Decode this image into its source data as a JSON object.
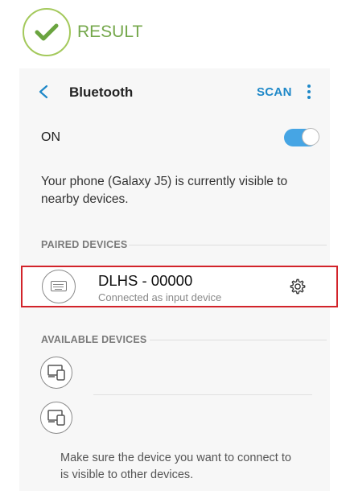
{
  "result": {
    "label": "RESULT",
    "icon": "checkmark-circle-icon",
    "color": "#74a74a"
  },
  "appbar": {
    "back_icon": "chevron-left-icon",
    "title": "Bluetooth",
    "scan_label": "SCAN",
    "more_icon": "more-vertical-icon",
    "accent": "#1e88c8"
  },
  "bluetooth": {
    "state_label": "ON",
    "toggle_on": true,
    "visibility_message": "Your phone (Galaxy J5) is currently visible to nearby devices."
  },
  "paired": {
    "header": "PAIRED DEVICES",
    "devices": [
      {
        "name": "DLHS - 00000",
        "status": "Connected as input device",
        "icon": "keyboard-icon",
        "settings_icon": "gear-icon",
        "highlight_color": "#d2232a"
      }
    ]
  },
  "available": {
    "header": "AVAILABLE DEVICES",
    "devices": [
      {
        "name": "",
        "icon": "devices-icon"
      },
      {
        "name": "",
        "icon": "devices-icon"
      }
    ],
    "note": "Make sure the device you want to connect to is visible to other devices."
  }
}
